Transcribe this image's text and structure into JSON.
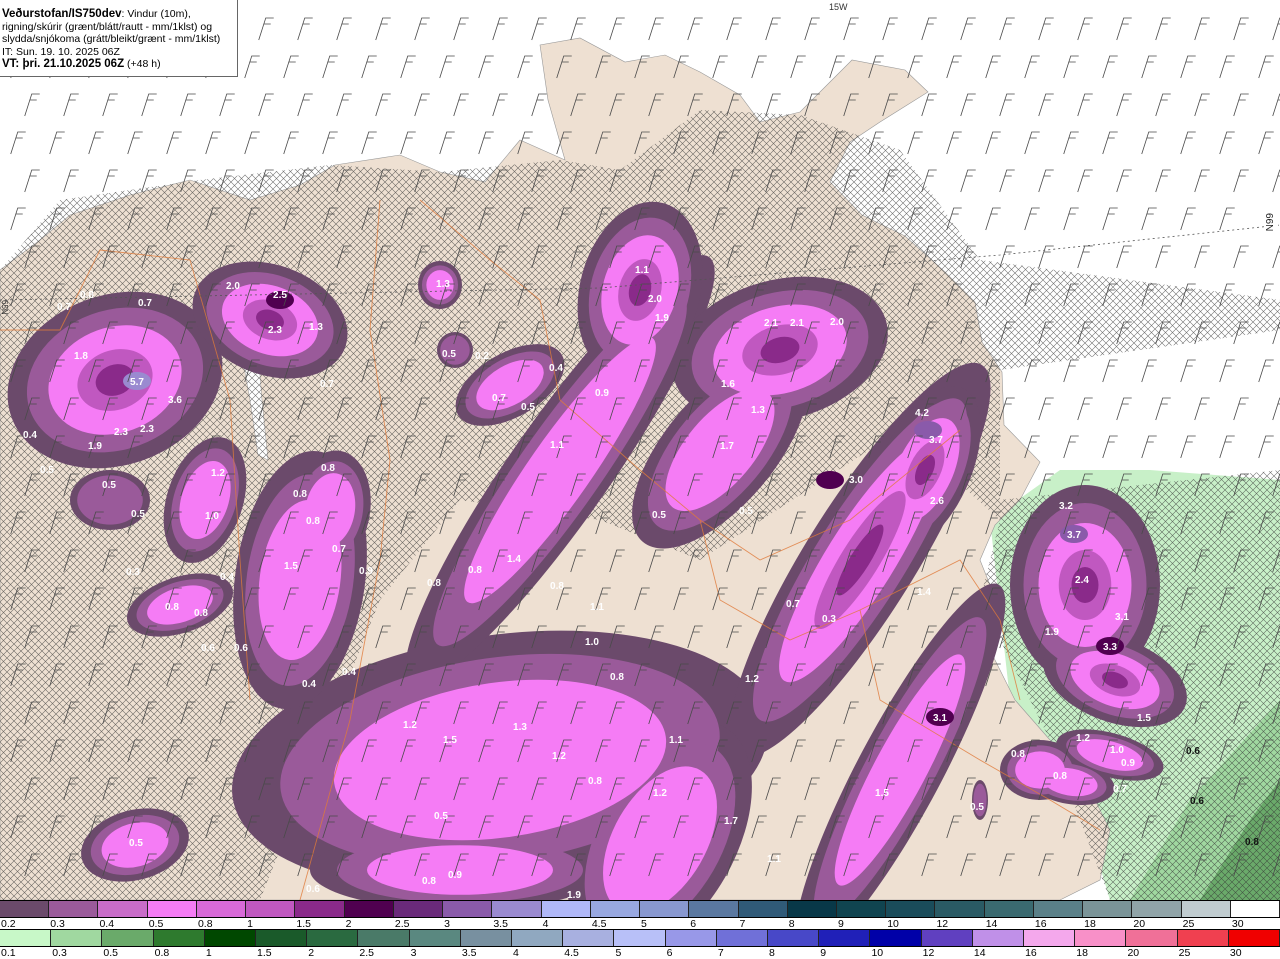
{
  "header": {
    "source": "Veðurstofan/IS750dev",
    "desc1": ": Vindur (10m),",
    "desc2": "rigning/skúrir (grænt/blátt/rautt - mm/1klst) og",
    "desc3": "slydda/snjókoma (grátt/bleikt/grænt - mm/1klst)",
    "init_time": "IT: Sun. 19. 10. 2025 06Z",
    "valid_label": "VT: þri. 21.10.2025 06Z",
    "valid_offset": " (+48 h)"
  },
  "grid_labels": {
    "lon": "15W",
    "lat_right": "66N",
    "lat_left": "65N"
  },
  "colors": {
    "sea": "#ffffff",
    "land": "#eee0d2",
    "border": "#e07a3a",
    "barb": "#4a4a4a"
  },
  "legend_snow": {
    "labels": [
      "0.2",
      "0.3",
      "0.4",
      "0.5",
      "0.8",
      "1",
      "1.5",
      "2",
      "2.5",
      "3",
      "3.5",
      "4",
      "4.5",
      "5",
      "6",
      "7",
      "8",
      "9",
      "10",
      "12",
      "14",
      "16",
      "18",
      "20",
      "25",
      "30"
    ],
    "colors": [
      "#6b4a6b",
      "#9a5a9a",
      "#c86cc8",
      "#f57cf5",
      "#d86ad8",
      "#c058c0",
      "#8a2a8a",
      "#500050",
      "#6a2a7a",
      "#8a5aaa",
      "#9a8ad0",
      "#b0b8f8",
      "#98a8e0",
      "#8898d0",
      "#5a78a0",
      "#305a78",
      "#083848",
      "#104450",
      "#1a4c5a",
      "#2a5a64",
      "#3a6a70",
      "#5a8088",
      "#7a9498",
      "#90a4a8",
      "#c0ccd0",
      "#ffffff"
    ]
  },
  "legend_rain": {
    "labels": [
      "0.1",
      "0.3",
      "0.5",
      "0.8",
      "1",
      "1.5",
      "2",
      "2.5",
      "3",
      "3.5",
      "4",
      "4.5",
      "5",
      "6",
      "7",
      "8",
      "9",
      "10",
      "12",
      "14",
      "16",
      "18",
      "20",
      "25",
      "30"
    ],
    "colors": [
      "#c8f8c8",
      "#a0d8a0",
      "#6aaa6a",
      "#2e7a2e",
      "#004800",
      "#1a5a2a",
      "#2a6a40",
      "#4a7a68",
      "#5a8880",
      "#7890a0",
      "#90a8c0",
      "#a8b0e0",
      "#b8c0f8",
      "#9898e8",
      "#7070d8",
      "#4848c8",
      "#2020b8",
      "#0000a8",
      "#6040c0",
      "#c090e8",
      "#f4a8ec",
      "#f890c8",
      "#f07098",
      "#f04050",
      "#f00000"
    ]
  },
  "map_values": [
    "0.8",
    "0.7",
    "0.7",
    "1.8",
    "5.7",
    "3.6",
    "0.4",
    "2.3",
    "2.3",
    "1.9",
    "0.5",
    "0.5",
    "0.5",
    "0.3",
    "0.8",
    "0.8",
    "0.4",
    "2.0",
    "2.5",
    "2.3",
    "1.3",
    "0.7",
    "1.3",
    "0.5",
    "0.2",
    "0.4",
    "0.7",
    "0.5",
    "0.9",
    "1.1",
    "2.0",
    "1.9",
    "2.1",
    "2.1",
    "2.0",
    "1.6",
    "1.3",
    "1.7",
    "1.1",
    "4.2",
    "3.7",
    "3.0",
    "2.6",
    "0.5",
    "0.5",
    "1.2",
    "1.0",
    "0.8",
    "0.8",
    "0.8",
    "0.7",
    "1.5",
    "0.9",
    "1.4",
    "0.8",
    "0.8",
    "0.8",
    "1.1",
    "1.0",
    "0.7",
    "0.3",
    "1.4",
    "3.2",
    "3.7",
    "2.4",
    "3.1",
    "1.9",
    "3.3",
    "1.5",
    "1.2",
    "1.0",
    "0.8",
    "0.8",
    "0.7",
    "0.9",
    "0.5",
    "0.6",
    "0.6",
    "0.8",
    "0.4",
    "0.4",
    "0.6",
    "0.6",
    "1.2",
    "1.5",
    "1.3",
    "1.2",
    "0.5",
    "0.8",
    "0.8",
    "1.2",
    "1.1",
    "1.2",
    "1.7",
    "1.1",
    "1.5",
    "3.1",
    "0.5",
    "0.6",
    "0.8",
    "0.9",
    "1.9"
  ]
}
